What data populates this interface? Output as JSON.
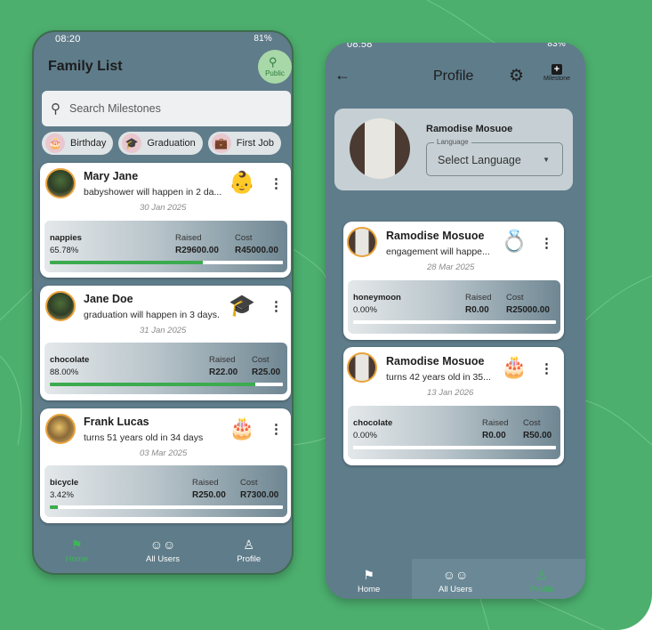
{
  "left": {
    "status_time": "08:20",
    "status_right": "81%",
    "title": "Family List",
    "public_label": "Public",
    "search_placeholder": "Search Milestones",
    "chips": [
      {
        "label": "Birthday",
        "icon": "🎂"
      },
      {
        "label": "Graduation",
        "icon": "🎓"
      },
      {
        "label": "First Job",
        "icon": "💼"
      }
    ],
    "cards": [
      {
        "name": "Mary Jane",
        "desc": "babyshower will happen in 2 da...",
        "date": "30 Jan 2025",
        "emoji": "👶",
        "item": "nappies",
        "percent": "65.78%",
        "progress": 0.6578,
        "raised_label": "Raised",
        "raised": "R29600.00",
        "cost_label": "Cost",
        "cost": "R45000.00"
      },
      {
        "name": "Jane Doe",
        "desc": "graduation will happen in 3 days.",
        "date": "31 Jan 2025",
        "emoji": "🎓",
        "item": "chocolate",
        "percent": "88.00%",
        "progress": 0.88,
        "raised_label": "Raised",
        "raised": "R22.00",
        "cost_label": "Cost",
        "cost": "R25.00"
      },
      {
        "name": "Frank Lucas",
        "desc": "turns 51 years old in 34 days",
        "date": "03 Mar 2025",
        "emoji": "🎂",
        "item": "bicycle",
        "percent": "3.42%",
        "progress": 0.0342,
        "raised_label": "Raised",
        "raised": "R250.00",
        "cost_label": "Cost",
        "cost": "R7300.00"
      }
    ],
    "nav": [
      {
        "label": "Home",
        "icon": "flag-icon",
        "active": true
      },
      {
        "label": "All Users",
        "icon": "users-icon",
        "active": false
      },
      {
        "label": "Profile",
        "icon": "person-icon",
        "active": false
      }
    ]
  },
  "right": {
    "status_time": "08:58",
    "status_right": "83%",
    "title": "Profile",
    "milestone_label": "Milestone",
    "profile_name": "Ramodise Mosuoe",
    "language_legend": "Language",
    "language_value": "Select Language",
    "cards": [
      {
        "name": "Ramodise Mosuoe",
        "desc": "engagement will happe...",
        "date": "28 Mar 2025",
        "emoji": "💍",
        "item": "honeymoon",
        "percent": "0.00%",
        "progress": 0.0,
        "raised_label": "Raised",
        "raised": "R0.00",
        "cost_label": "Cost",
        "cost": "R25000.00"
      },
      {
        "name": "Ramodise Mosuoe",
        "desc": "turns 42 years old in 35...",
        "date": "13 Jan 2026",
        "emoji": "🎂",
        "item": "chocolate",
        "percent": "0.00%",
        "progress": 0.0,
        "raised_label": "Raised",
        "raised": "R0.00",
        "cost_label": "Cost",
        "cost": "R50.00"
      }
    ],
    "nav": [
      {
        "label": "Home",
        "icon": "flag-icon",
        "active": false
      },
      {
        "label": "All Users",
        "icon": "users-icon",
        "active": false
      },
      {
        "label": "Profile",
        "icon": "person-icon",
        "active": true
      }
    ]
  },
  "colors": {
    "background": "#4caf6e",
    "phone": "#5f7c8a",
    "accent": "#3cab4f",
    "avatar_ring": "#e9a23b"
  }
}
